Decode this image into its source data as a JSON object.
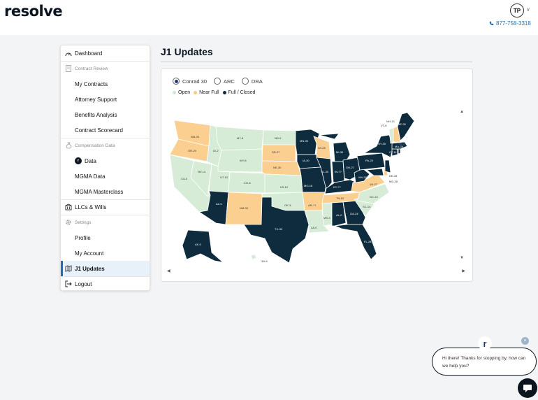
{
  "header": {
    "logo_text": "resolve",
    "avatar_initials": "TP",
    "phone": "877-758-3318"
  },
  "sidebar": {
    "items": [
      {
        "label": "Dashboard",
        "icon": "dashboard-icon"
      },
      {
        "label": "Contract Review",
        "icon": "document-icon"
      },
      {
        "label": "My Contracts"
      },
      {
        "label": "Attorney Support"
      },
      {
        "label": "Benefits Analysis"
      },
      {
        "label": "Contract Scorecard"
      },
      {
        "label": "Compensation Data",
        "icon": "money-bag-icon"
      },
      {
        "label": "Data",
        "badge": "r"
      },
      {
        "label": "MGMA Data"
      },
      {
        "label": "MGMA Masterclass"
      },
      {
        "label": "LLCs & Wills",
        "icon": "building-icon"
      },
      {
        "label": "Settings",
        "icon": "gear-icon"
      },
      {
        "label": "Profile"
      },
      {
        "label": "My Account"
      },
      {
        "label": "J1 Updates",
        "icon": "map-icon"
      },
      {
        "label": "Logout",
        "icon": "logout-icon"
      }
    ]
  },
  "main": {
    "title": "J1 Updates",
    "program_options": [
      "Conrad 30",
      "ARC",
      "DRA"
    ],
    "selected_program": "Conrad 30",
    "legend": [
      {
        "label": "Open",
        "color": "#cfe8d2"
      },
      {
        "label": "Near Full",
        "color": "#f7c98b"
      },
      {
        "label": "Full / Closed",
        "color": "#0e2c3d"
      }
    ]
  },
  "map": {
    "colors": {
      "open": "#d6ecd7",
      "near": "#fbcf8f",
      "full": "#0e2c3d"
    },
    "state_labels": [
      "WA-30",
      "OR-29",
      "ID-2",
      "MT-8",
      "ND-9",
      "MN-30",
      "WI-28",
      "MI-30",
      "SD-27",
      "NE-30",
      "IA-30",
      "IL-30",
      "IN-??",
      "OH-27",
      "PA-25",
      "NY-30",
      "VT-6",
      "NH-13",
      "ME-30",
      "MA-28",
      "CT-11",
      "RI-??",
      "NJ-30",
      "DE-28",
      "MD-28",
      "WY-5",
      "CO-8",
      "UT-13",
      "NV-14",
      "CA-0",
      "AZ-0",
      "NM-30",
      "KS-12",
      "OK-3",
      "MO-18",
      "KY-??",
      "WV-30",
      "VA-27",
      "TN-19",
      "NC-13",
      "AR-??",
      "MS-3",
      "AL-0",
      "GA-24",
      "SC-14",
      "LA-0",
      "TX-30",
      "FL-28",
      "AK-0",
      "HI-5"
    ]
  },
  "chat": {
    "message_line1": "Hi there! Thanks for stopping by, how can",
    "message_line2": "we help you?",
    "logo_letter": "r",
    "close_symbol": "×"
  }
}
